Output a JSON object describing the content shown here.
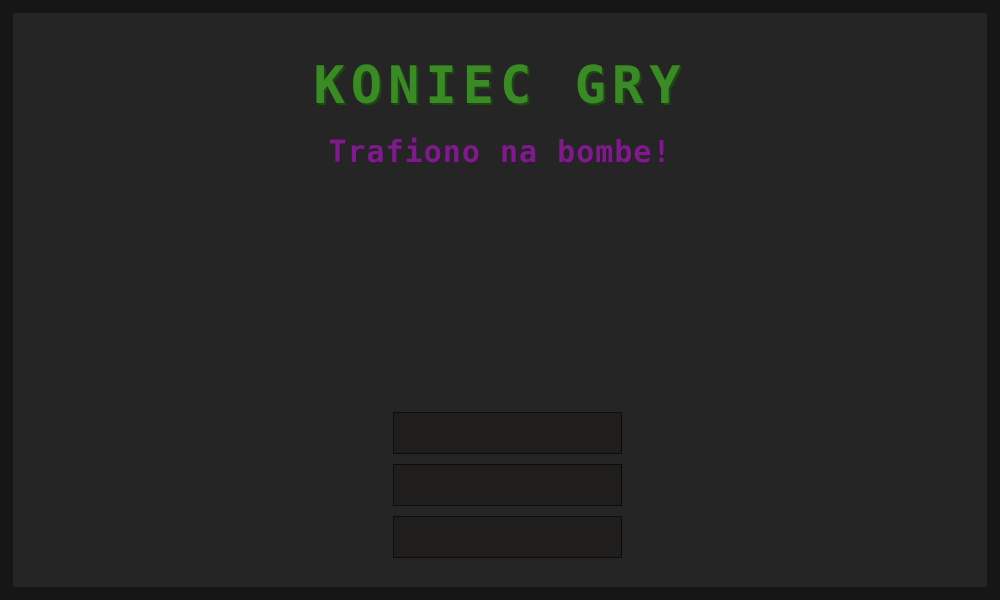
{
  "game_over": {
    "title": "KONIEC GRY",
    "subtitle": "Trafiono na bombe!"
  },
  "menu": {
    "buttons": [
      {
        "label": ""
      },
      {
        "label": ""
      },
      {
        "label": ""
      }
    ]
  },
  "colors": {
    "background": "#262526",
    "border": "#161616",
    "title": "#3a8a25",
    "subtitle": "#7a1d86",
    "button": "#1f1e1c"
  }
}
